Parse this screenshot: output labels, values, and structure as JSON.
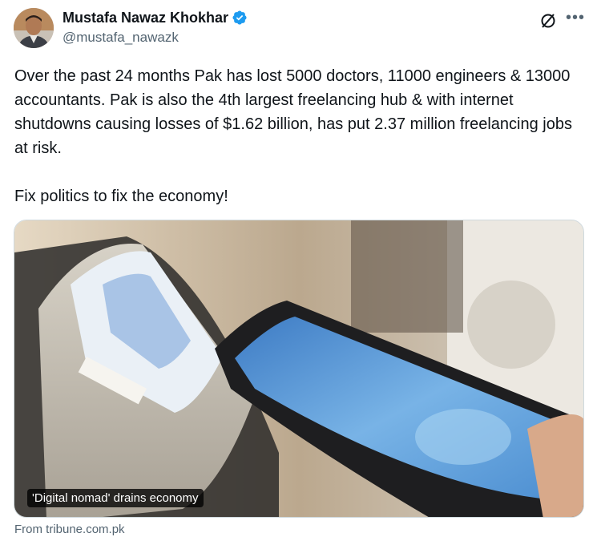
{
  "author": {
    "display_name": "Mustafa Nawaz Khokhar",
    "handle": "@mustafa_nawazk",
    "verified": true,
    "verified_color": "#1d9bf0"
  },
  "icons": {
    "grok": "grok-icon",
    "more": "more-options-icon",
    "verified": "verified-badge-icon"
  },
  "tweet": {
    "paragraphs": [
      "Over the past 24 months Pak has lost 5000 doctors, 11000 engineers & 13000 accountants. Pak is also the 4th largest freelancing hub & with internet shutdowns causing losses of $1.62 billion, has put 2.37 million freelancing jobs at risk.",
      "Fix politics to fix the economy!"
    ]
  },
  "link_card": {
    "caption": "'Digital nomad' drains economy",
    "source": "From tribune.com.pk"
  },
  "colors": {
    "text_primary": "#0f1419",
    "text_secondary": "#536471",
    "border": "#cfd9de"
  }
}
